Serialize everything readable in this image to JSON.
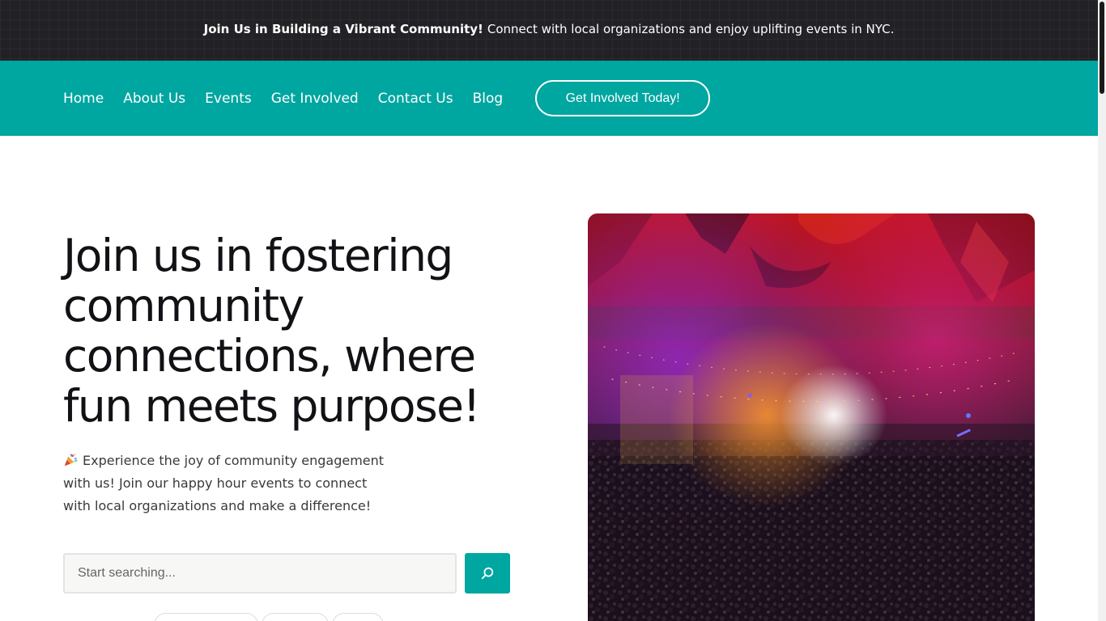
{
  "announcement": {
    "bold": "Join Us in Building a Vibrant Community!",
    "text": "Connect with local organizations and enjoy uplifting events in NYC."
  },
  "nav": {
    "items": [
      {
        "label": "Home"
      },
      {
        "label": "About Us"
      },
      {
        "label": "Events"
      },
      {
        "label": "Get Involved"
      },
      {
        "label": "Contact Us"
      },
      {
        "label": "Blog"
      }
    ],
    "cta": "Get Involved Today!"
  },
  "hero": {
    "title": "Join us in fostering community connections, where fun meets purpose!",
    "description": "Experience the joy of community engagement with us! Join our happy hour events to connect with local organizations and make a difference!",
    "emoji_icon": "party-popper-icon"
  },
  "search": {
    "placeholder": "Start searching...",
    "value": "",
    "button_icon": "search-icon"
  },
  "colors": {
    "accent": "#00a6a0",
    "topbar": "#222226"
  }
}
